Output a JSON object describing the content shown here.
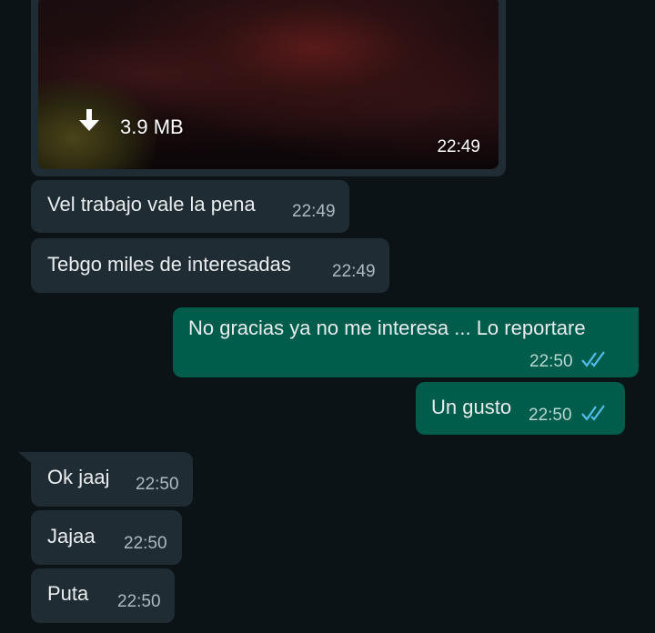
{
  "media": {
    "size": "3.9 MB",
    "time": "22:49",
    "download_icon": "download-arrow-icon"
  },
  "messages": [
    {
      "direction": "in",
      "text": "Vel trabajo vale la pena",
      "time": "22:49"
    },
    {
      "direction": "in",
      "text": "Tebgo miles de interesadas",
      "time": "22:49"
    },
    {
      "direction": "out",
      "text": "No gracias ya no me interesa ... Lo reportare",
      "time": "22:50",
      "status_icon": "double-check-read-icon"
    },
    {
      "direction": "out",
      "text": "Un gusto",
      "time": "22:50",
      "status_icon": "double-check-read-icon"
    },
    {
      "direction": "in",
      "text": "Ok jaaj",
      "time": "22:50"
    },
    {
      "direction": "in",
      "text": "Jajaa",
      "time": "22:50"
    },
    {
      "direction": "in",
      "text": "Puta",
      "time": "22:50"
    }
  ],
  "colors": {
    "background": "#0c1317",
    "incoming_bubble": "#1f2c33",
    "outgoing_bubble": "#005c4b",
    "read_tick": "#53bdeb"
  }
}
